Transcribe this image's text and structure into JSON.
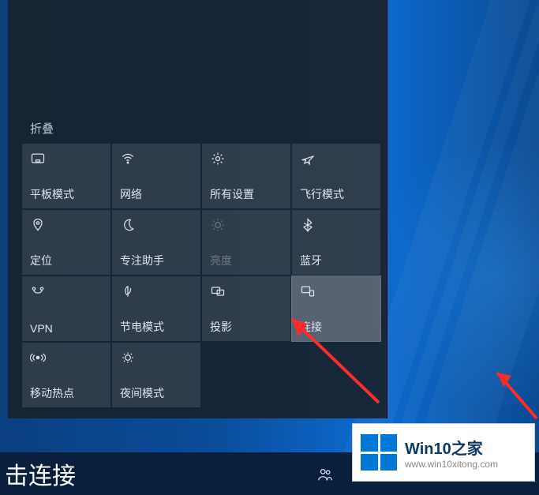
{
  "action_center": {
    "collapse_label": "折叠",
    "tiles": [
      {
        "id": "tablet-mode",
        "icon": "tablet",
        "label": "平板模式"
      },
      {
        "id": "network",
        "icon": "wifi",
        "label": "网络"
      },
      {
        "id": "all-settings",
        "icon": "gear",
        "label": "所有设置"
      },
      {
        "id": "airplane-mode",
        "icon": "airplane",
        "label": "飞行模式"
      },
      {
        "id": "location",
        "icon": "location",
        "label": "定位"
      },
      {
        "id": "focus-assist",
        "icon": "moon",
        "label": "专注助手"
      },
      {
        "id": "brightness",
        "icon": "sun",
        "label": "亮度",
        "dim": true
      },
      {
        "id": "bluetooth",
        "icon": "bluetooth",
        "label": "蓝牙"
      },
      {
        "id": "vpn",
        "icon": "vpn",
        "label": "VPN"
      },
      {
        "id": "battery-saver",
        "icon": "leaf",
        "label": "节电模式"
      },
      {
        "id": "project",
        "icon": "project",
        "label": "投影"
      },
      {
        "id": "connect",
        "icon": "connect",
        "label": "连接",
        "highlight": true
      },
      {
        "id": "mobile-hotspot",
        "icon": "hotspot",
        "label": "移动热点"
      },
      {
        "id": "night-light",
        "icon": "nightlight",
        "label": "夜间模式"
      }
    ]
  },
  "annotation": {
    "caption_text": "击连接"
  },
  "watermark": {
    "title": "Win10之家",
    "url": "www.win10xitong.com"
  }
}
